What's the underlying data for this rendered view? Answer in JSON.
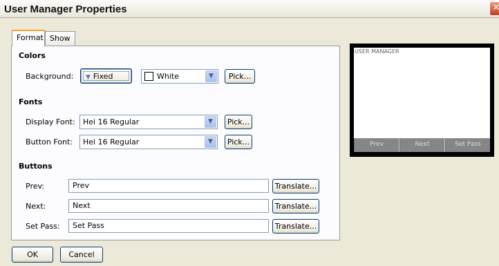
{
  "window": {
    "title": "User Manager Properties",
    "close_glyph": "✕"
  },
  "tabs": [
    {
      "label": "Format",
      "active": true
    },
    {
      "label": "Show",
      "active": false
    }
  ],
  "colors_section": {
    "title": "Colors",
    "background_label": "Background:",
    "fill_mode": "Fixed",
    "color_value": "White",
    "pick_label": "Pick..."
  },
  "fonts_section": {
    "title": "Fonts",
    "display_font_label": "Display Font:",
    "display_font_value": "Hei 16 Regular",
    "button_font_label": "Button Font:",
    "button_font_value": "Hei 16 Regular",
    "pick_label": "Pick..."
  },
  "buttons_section": {
    "title": "Buttons",
    "rows": [
      {
        "label": "Prev:",
        "value": "Prev",
        "translate_label": "Translate..."
      },
      {
        "label": "Next:",
        "value": "Next",
        "translate_label": "Translate..."
      },
      {
        "label": "Set Pass:",
        "value": "Set Pass",
        "translate_label": "Translate..."
      }
    ]
  },
  "preview": {
    "screen_title": "USER MANAGER",
    "soft_keys": [
      "Prev",
      "Next",
      "Set Pass"
    ]
  },
  "footer": {
    "ok_label": "OK",
    "cancel_label": "Cancel"
  },
  "icons": {
    "dropdown": "chevron-down-icon",
    "fill_mode": "triangle-down-icon",
    "close": "close-icon"
  }
}
